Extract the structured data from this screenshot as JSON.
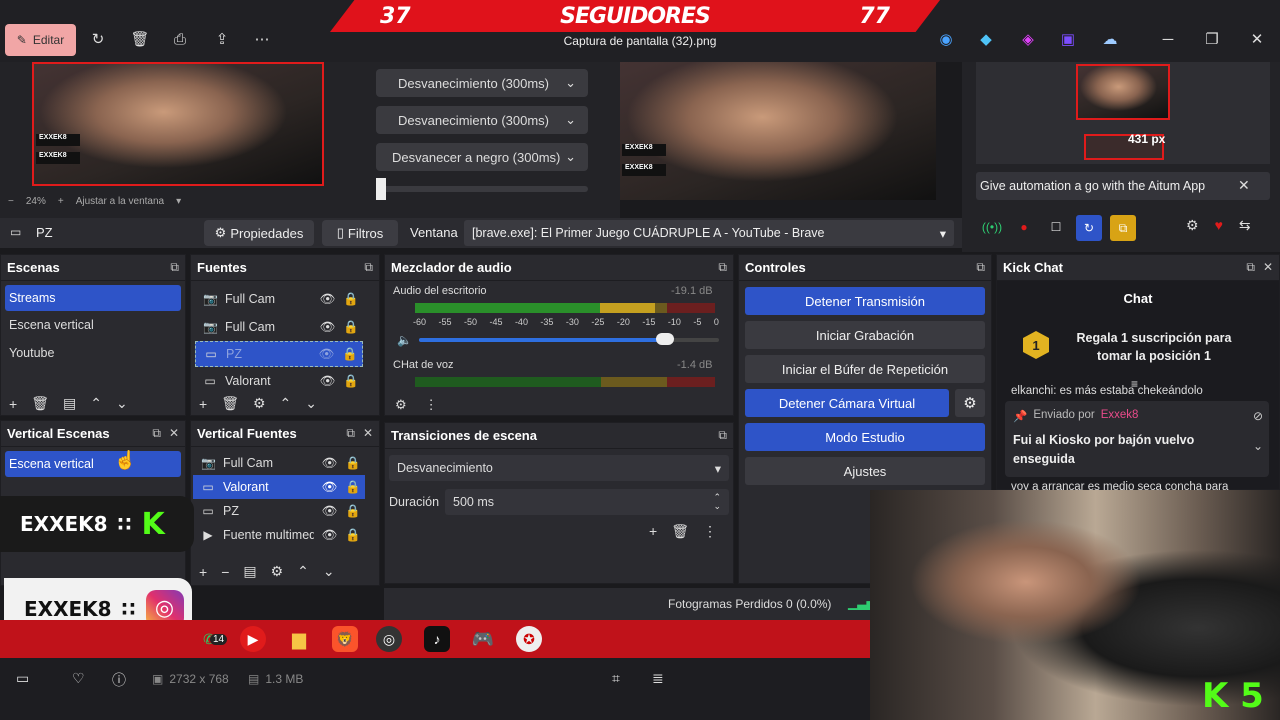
{
  "top": {
    "followers_left": "37",
    "followers_label": "SEGUIDORES",
    "followers_right": "77",
    "edit_label": "Editar",
    "file_title": "Captura de pantalla (32).png"
  },
  "preview": {
    "zoom": "24%",
    "fit_label": "Ajustar a la ventana",
    "px_label": "431 px",
    "overlay_name": "EXXEK8",
    "overlay_k": "K 5"
  },
  "transitions_dd": [
    "Desvanecimiento (300ms)",
    "Desvanecimiento (300ms)",
    "Desvanecer a negro (300ms)"
  ],
  "aitum": {
    "banner": "Give automation a go with the Aitum App"
  },
  "props": {
    "scene_name": "PZ",
    "props_label": "Propiedades",
    "filters_label": "Filtros",
    "window_label": "Ventana",
    "window_value": "[brave.exe]: El Primer Juego CUÁDRUPLE A - YouTube - Brave"
  },
  "scenes": {
    "title": "Escenas",
    "items": [
      "Streams",
      "Escena vertical",
      "Youtube"
    ]
  },
  "sources": {
    "title": "Fuentes",
    "items": [
      "Full Cam",
      "Full Cam",
      "PZ",
      "Valorant"
    ]
  },
  "mixer": {
    "title": "Mezclador de audio",
    "ch1": "Audio del escritorio",
    "ch1_db": "-19.1 dB",
    "ch2": "CHat de voz",
    "ch2_db": "-1.4 dB",
    "ticks": [
      "-60",
      "-55",
      "-50",
      "-45",
      "-40",
      "-35",
      "-30",
      "-25",
      "-20",
      "-15",
      "-10",
      "-5",
      "0"
    ],
    "ch1_level": 0.8,
    "volume": 0.82
  },
  "controls": {
    "title": "Controles",
    "buttons": [
      "Detener Transmisión",
      "Iniciar Grabación",
      "Iniciar el Búfer de Repetición",
      "Detener Cámara Virtual",
      "Modo Estudio",
      "Ajustes"
    ]
  },
  "chat": {
    "title": "Kick Chat",
    "header": "Chat",
    "gift_rank": "1",
    "gift_text": "Regala 1 suscripción para tomar la posición 1",
    "cut_msg": "elkanchi: es más estaba chekeándolo",
    "pinned_by": "Enviado por",
    "pinned_user": "Exxek8",
    "pinned_msg": "Fui al Kiosko por bajón vuelvo enseguida",
    "cut_msg2": "voy a arrancar es medio seca concha para"
  },
  "vscenes": {
    "title": "Vertical Escenas",
    "items": [
      "Escena vertical"
    ]
  },
  "vsources": {
    "title": "Vertical Fuentes",
    "items": [
      "Full Cam",
      "Valorant",
      "PZ",
      "Fuente multimedia"
    ]
  },
  "trans": {
    "title": "Transiciones de escena",
    "type": "Desvanecimiento",
    "duration_label": "Duración",
    "duration": "500 ms"
  },
  "status": {
    "dropped": "Fotogramas Perdidos 0 (0.0%)"
  },
  "overlays": {
    "kick_name": "EXXEK8",
    "ig_name": "EXXEK8"
  },
  "bottom": {
    "dimensions": "2732 x 768",
    "size": "1.3 MB",
    "badge": "14"
  }
}
